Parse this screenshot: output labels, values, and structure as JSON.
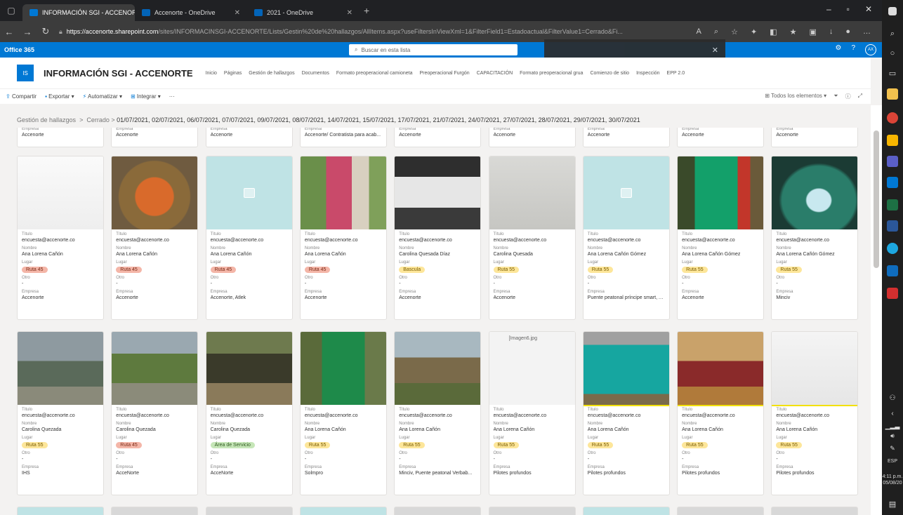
{
  "browser": {
    "tabs": [
      {
        "title": "INFORMACIÓN SGI - ACCENORT",
        "active": true,
        "color": "#0078d4"
      },
      {
        "title": "Accenorte - OneDrive",
        "active": false,
        "color": "#0364b8"
      },
      {
        "title": "2021 - OneDrive",
        "active": false,
        "color": "#0364b8"
      }
    ],
    "url_host": "https://accenorte.sharepoint.com",
    "url_path": "/sites/INFORMACINSGI-ACCENORTE/Lists/Gestin%20de%20hallazgos/AllItems.aspx?useFiltersInViewXml=1&FilterField1=Estadoactual&FilterValue1=Cerrado&Fi..."
  },
  "suite": {
    "brand": "Office 365",
    "search_placeholder": "Buscar en esta lista",
    "avatar": "AX"
  },
  "site": {
    "logo": "IS",
    "title": "INFORMACIÓN SGI - ACCENORTE",
    "nav": [
      "Inicio",
      "Páginas",
      "Gestión de hallazgos",
      "Documentos",
      "Formato preoperacional camioneta",
      "Preoperacional Furgón",
      "CAPACITACIÓN",
      "Formato preoperacional grua",
      "Comienzo de sitio",
      "Inspección",
      "EPP 2.0"
    ]
  },
  "commands": {
    "left": [
      "Compartir",
      "Exportar",
      "Automatizar",
      "Integrar",
      "···"
    ],
    "view": "Todos los elementos"
  },
  "breadcrumb": {
    "root": "Gestión de hallazgos",
    "state": "Cerrado",
    "dates": "01/07/2021, 02/07/2021, 06/07/2021, 07/07/2021, 09/07/2021, 08/07/2021, 14/07/2021, 15/07/2021, 17/07/2021, 21/07/2021, 24/07/2021, 27/07/2021, 28/07/2021, 29/07/2021, 30/07/2021"
  },
  "labels": {
    "titulo": "Título",
    "nombre": "Nombre",
    "lugar": "Lugar",
    "otro": "Otro",
    "empresa": "Empresa",
    "dash": "-"
  },
  "top_row": [
    "Accenorte",
    "Accenorte",
    "Accenorte",
    "Accenorte/ Contratista para acab...",
    "Accenorte",
    "Accenorte",
    "Accenorte",
    "Accenorte",
    "Accenorte"
  ],
  "row1": [
    {
      "titulo": "encuesta@accenorte.co",
      "nombre": "Ana Lorena Cañón",
      "lugar": "Ruta 45",
      "pill": "red",
      "empresa": "Accenorte",
      "img": "doc"
    },
    {
      "titulo": "encuesta@accenorte.co",
      "nombre": "Ana Lorena Cañón",
      "lugar": "Ruta 45",
      "pill": "red",
      "empresa": "Accenorte",
      "img": "orange"
    },
    {
      "titulo": "encuesta@accenorte.co",
      "nombre": "Ana Lorena Cañón",
      "lugar": "Ruta 45",
      "pill": "red",
      "empresa": "Accenorte, Atlek",
      "img": "placeholder"
    },
    {
      "titulo": "encuesta@accenorte.co",
      "nombre": "Ana Lorena Cañón",
      "lugar": "Ruta 45",
      "pill": "red",
      "empresa": "Accenorte",
      "img": "bottle"
    },
    {
      "titulo": "encuesta@accenorte.co",
      "nombre": "Carolina Quesada Díaz",
      "lugar": "Bascula",
      "pill": "yellow",
      "empresa": "Accenorte",
      "img": "shelf"
    },
    {
      "titulo": "encuesta@accenorte.co",
      "nombre": "Carolina Quesada",
      "lugar": "Ruta 55",
      "pill": "yellow",
      "empresa": "Accenorte",
      "img": "paper"
    },
    {
      "titulo": "encuesta@accenorte.co",
      "nombre": "Ana Lorena Cañón Gómez",
      "lugar": "Ruta 55",
      "pill": "yellow",
      "empresa": "Puente peatonal príncipe smart, Acc...",
      "img": "placeholder"
    },
    {
      "titulo": "encuesta@accenorte.co",
      "nombre": "Ana Lorena Cañón Gómez",
      "lugar": "Ruta 55",
      "pill": "yellow",
      "empresa": "Accenorte",
      "img": "extinguisher"
    },
    {
      "titulo": "encuesta@accenorte.co",
      "nombre": "Ana Lorena Cañón Gómez",
      "lugar": "Ruta 55",
      "pill": "yellow",
      "empresa": "Minciv",
      "img": "gel"
    }
  ],
  "row2": [
    {
      "titulo": "encuesta@accenorte.co",
      "nombre": "Carolina Quezada",
      "lugar": "Ruta 55",
      "pill": "yellow",
      "empresa": "IHS",
      "img": "tower"
    },
    {
      "titulo": "encuesta@accenorte.co",
      "nombre": "Carolina Quezada",
      "lugar": "Ruta 45",
      "pill": "red",
      "empresa": "AcceNorte",
      "img": "wheelbarrow"
    },
    {
      "titulo": "encuesta@accenorte.co",
      "nombre": "Carolina Quezada",
      "lugar": "Área de Servicio",
      "pill": "green",
      "empresa": "AcceNorte",
      "img": "pit"
    },
    {
      "titulo": "encuesta@accenorte.co",
      "nombre": "Ana Lorena Cañón",
      "lugar": "Ruta 55",
      "pill": "yellow",
      "empresa": "Solmpro",
      "img": "toilet"
    },
    {
      "titulo": "encuesta@accenorte.co",
      "nombre": "Ana Lorena Cañón",
      "lugar": "Ruta 55",
      "pill": "yellow",
      "empresa": "Minciv, Puente peatonal Verbab...",
      "img": "site"
    },
    {
      "titulo": "encuesta@accenorte.co",
      "nombre": "Ana Lorena Cañón",
      "lugar": "Ruta 55",
      "pill": "yellow",
      "empresa": "Pilotes profundos",
      "img": "broken",
      "alt": "[Imagen6.jpg"
    },
    {
      "titulo": "encuesta@accenorte.co",
      "nombre": "Ana Lorena Cañón",
      "lugar": "Ruta 55",
      "pill": "yellow",
      "empresa": "Pilotes profundos",
      "img": "extinguisher2"
    },
    {
      "titulo": "encuesta@accenorte.co",
      "nombre": "Ana Lorena Cañón",
      "lugar": "Ruta 55",
      "pill": "yellow",
      "empresa": "Pilotes profundos",
      "img": "bags"
    },
    {
      "titulo": "encuesta@accenorte.co",
      "nombre": "Ana Lorena Cañón",
      "lugar": "Ruta 55",
      "pill": "yellow",
      "empresa": "Pilotes profundos",
      "img": "form"
    }
  ],
  "taskbar": {
    "lang": "ESP",
    "time": "4:11 p.m.",
    "date": "05/08/20"
  }
}
